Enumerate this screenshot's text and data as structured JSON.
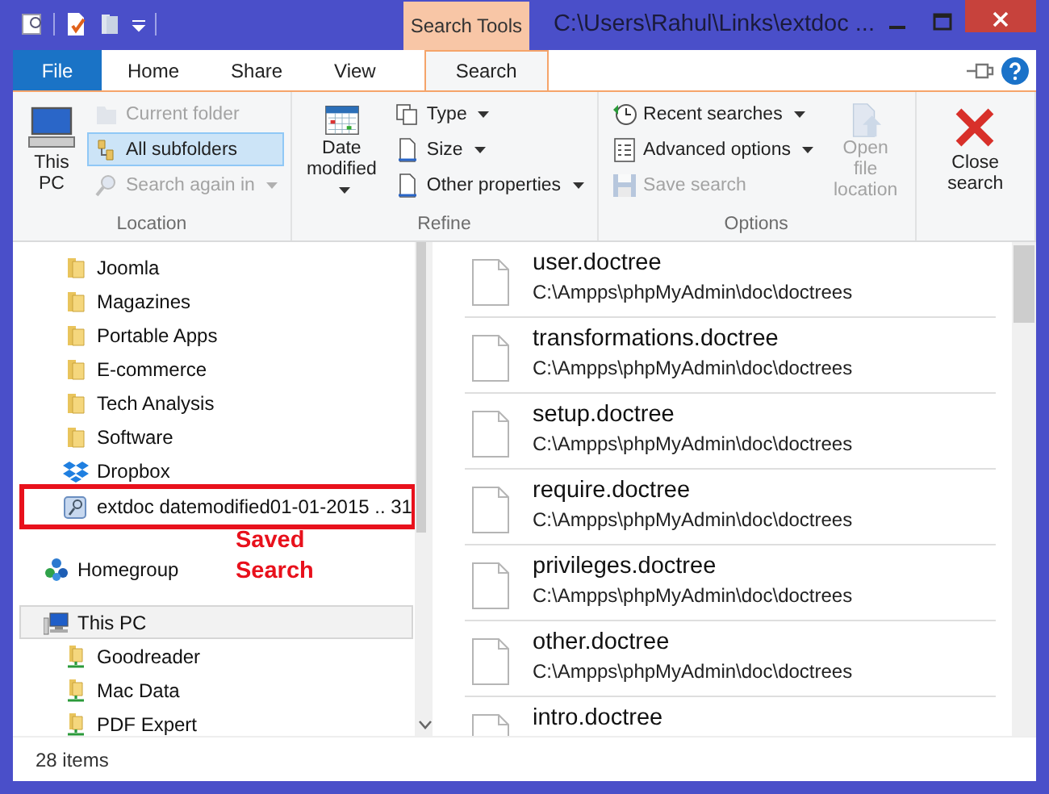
{
  "title_bar": {
    "contextual_tab": "Search Tools",
    "title": "C:\\Users\\Rahul\\Links\\extdoc ..."
  },
  "ribbon_tabs": [
    {
      "label": "File",
      "kind": "file",
      "selected": false
    },
    {
      "label": "Home",
      "kind": "tab",
      "selected": false
    },
    {
      "label": "Share",
      "kind": "tab",
      "selected": false
    },
    {
      "label": "View",
      "kind": "tab",
      "selected": false
    },
    {
      "label": "Search",
      "kind": "tab",
      "selected": true
    }
  ],
  "ribbon_groups": [
    {
      "label": "Location",
      "columns": [
        [
          {
            "label": "This PC",
            "kind": "large",
            "disabled": false,
            "dropdown": false,
            "selected": false
          }
        ],
        [
          {
            "label": "Current folder",
            "kind": "small",
            "disabled": true,
            "dropdown": false,
            "selected": false
          },
          {
            "label": "All subfolders",
            "kind": "small",
            "disabled": false,
            "dropdown": false,
            "selected": true
          },
          {
            "label": "Search again in",
            "kind": "small",
            "disabled": true,
            "dropdown": true,
            "selected": false
          }
        ]
      ]
    },
    {
      "label": "Refine",
      "columns": [
        [
          {
            "label": "Date modified",
            "kind": "large",
            "disabled": false,
            "dropdown": true,
            "selected": false
          }
        ],
        [
          {
            "label": "Type",
            "kind": "small",
            "disabled": false,
            "dropdown": true,
            "selected": false
          },
          {
            "label": "Size",
            "kind": "small",
            "disabled": false,
            "dropdown": true,
            "selected": false
          },
          {
            "label": "Other properties",
            "kind": "small",
            "disabled": false,
            "dropdown": true,
            "selected": false
          }
        ]
      ]
    },
    {
      "label": "Options",
      "columns": [
        [
          {
            "label": "Recent searches",
            "kind": "small",
            "disabled": false,
            "dropdown": true,
            "selected": false
          },
          {
            "label": "Advanced options",
            "kind": "small",
            "disabled": false,
            "dropdown": true,
            "selected": false
          },
          {
            "label": "Save search",
            "kind": "small",
            "disabled": true,
            "dropdown": false,
            "selected": false
          }
        ],
        [
          {
            "label": "Open file location",
            "kind": "large",
            "disabled": true,
            "dropdown": false,
            "selected": false
          }
        ]
      ]
    },
    {
      "columns": [
        [
          {
            "label": "Close search",
            "kind": "large",
            "disabled": false,
            "dropdown": false,
            "selected": false
          }
        ]
      ]
    }
  ],
  "nav_pane": {
    "items": [
      {
        "label": "Joomla",
        "kind": "folder",
        "highlighted": false
      },
      {
        "label": "Magazines",
        "kind": "folder",
        "highlighted": false
      },
      {
        "label": "Portable Apps",
        "kind": "folder",
        "highlighted": false
      },
      {
        "label": "E-commerce",
        "kind": "folder",
        "highlighted": false
      },
      {
        "label": "Tech Analysis",
        "kind": "folder",
        "highlighted": false
      },
      {
        "label": "Software",
        "kind": "folder",
        "highlighted": false
      },
      {
        "label": "Dropbox",
        "kind": "dropbox",
        "highlighted": false
      },
      {
        "label": "extdoc datemodified01-01-2015 .. 31",
        "kind": "saved-search",
        "highlighted": true
      }
    ],
    "annotation": "Saved Search",
    "roots": [
      {
        "label": "Homegroup",
        "kind": "homegroup",
        "hovered": false
      },
      {
        "label": "This PC",
        "kind": "computer",
        "hovered": true,
        "children": [
          {
            "label": "Goodreader",
            "kind": "network-folder"
          },
          {
            "label": "Mac Data",
            "kind": "network-folder"
          },
          {
            "label": "PDF Expert",
            "kind": "network-folder"
          }
        ]
      }
    ]
  },
  "files": [
    {
      "name": "user.doctree",
      "path": "C:\\Ampps\\phpMyAdmin\\doc\\doctrees"
    },
    {
      "name": "transformations.doctree",
      "path": "C:\\Ampps\\phpMyAdmin\\doc\\doctrees"
    },
    {
      "name": "setup.doctree",
      "path": "C:\\Ampps\\phpMyAdmin\\doc\\doctrees"
    },
    {
      "name": "require.doctree",
      "path": "C:\\Ampps\\phpMyAdmin\\doc\\doctrees"
    },
    {
      "name": "privileges.doctree",
      "path": "C:\\Ampps\\phpMyAdmin\\doc\\doctrees"
    },
    {
      "name": "other.doctree",
      "path": "C:\\Ampps\\phpMyAdmin\\doc\\doctrees"
    },
    {
      "name": "intro.doctree"
    }
  ],
  "status_bar": {
    "item_count": "28 items"
  }
}
